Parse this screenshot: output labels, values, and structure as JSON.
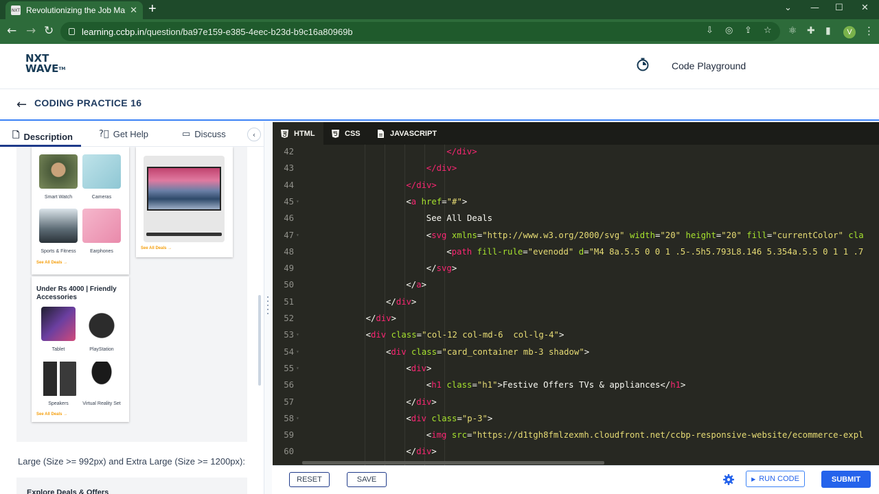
{
  "browser": {
    "tab_title": "Revolutionizing the Job Market |",
    "tab_favicon_text": "NXT",
    "new_tab": "+",
    "url_host": "learning.ccbp.in",
    "url_path": "/question/ba97e159-e385-4eec-b23d-b9c16a80969b",
    "profile_initial": "V"
  },
  "header": {
    "logo_line1": "NXT",
    "logo_line2": "WAVE",
    "logo_tm": "TM",
    "code_playground": "Code Playground",
    "page_title": "CODING PRACTICE 16"
  },
  "left_tabs": {
    "description": "Description",
    "get_help": "Get Help",
    "discuss": "Discuss"
  },
  "preview": {
    "cards": [
      {
        "title": "",
        "items": [
          "Smart Watch",
          "Cameras",
          "Sports & Fitness",
          "Earphones"
        ],
        "see_all": "See All Deals →"
      },
      {
        "title": "",
        "see_all": "See All Deals →"
      },
      {
        "title": "Under Rs 4000 | Friendly Accessories",
        "items": [
          "Tablet",
          "PlayStation",
          "Speakers",
          "Virtual Reality Set"
        ],
        "see_all": "See All Deals →"
      }
    ],
    "description_text": "Large (Size >= 992px) and Extra Large (Size >= 1200px):",
    "explore_title": "Explore Deals & Offers"
  },
  "editor": {
    "tabs": [
      "HTML",
      "CSS",
      "JAVASCRIPT"
    ],
    "active_tab": "HTML",
    "lines": [
      {
        "n": "42",
        "fold": "",
        "indent": 8,
        "html": "<span class='tg'>&lt;/div&gt;</span>"
      },
      {
        "n": "43",
        "fold": "",
        "indent": 7,
        "html": "<span class='tg'>&lt;/div&gt;</span>"
      },
      {
        "n": "44",
        "fold": "",
        "indent": 6,
        "html": "<span class='tg'>&lt;/div&gt;</span>"
      },
      {
        "n": "45",
        "fold": "▾",
        "indent": 6,
        "html": "&lt;<span class='tg'>a</span> <span class='at'>href</span>=<span class='st'>\"#\"</span>&gt;"
      },
      {
        "n": "46",
        "fold": "",
        "indent": 7,
        "html": "See All Deals"
      },
      {
        "n": "47",
        "fold": "▾",
        "indent": 7,
        "html": "&lt;<span class='tg'>svg</span> <span class='at'>xmlns</span>=<span class='st'>\"http://www.w3.org/2000/svg\"</span> <span class='at'>width</span>=<span class='st'>\"20\"</span> <span class='at'>height</span>=<span class='st'>\"20\"</span> <span class='at'>fill</span>=<span class='st'>\"currentColor\"</span> <span class='at'>cla</span>"
      },
      {
        "n": "48",
        "fold": "",
        "indent": 8,
        "html": "&lt;<span class='tg'>path</span> <span class='at'>fill-rule</span>=<span class='st'>\"evenodd\"</span> <span class='at'>d</span>=<span class='st'>\"M4 8a.5.5 0 0 1 .5-.5h5.793L8.146 5.354a.5.5 0 1 1 .7</span>"
      },
      {
        "n": "49",
        "fold": "",
        "indent": 7,
        "html": "&lt;/<span class='tg'>svg</span>&gt;"
      },
      {
        "n": "50",
        "fold": "",
        "indent": 6,
        "html": "&lt;/<span class='tg'>a</span>&gt;"
      },
      {
        "n": "51",
        "fold": "",
        "indent": 5,
        "html": "&lt;/<span class='tg'>div</span>&gt;"
      },
      {
        "n": "52",
        "fold": "",
        "indent": 4,
        "html": "&lt;/<span class='tg'>div</span>&gt;"
      },
      {
        "n": "53",
        "fold": "▾",
        "indent": 4,
        "html": "&lt;<span class='tg'>div</span> <span class='at'>class</span>=<span class='st'>\"col-12 col-md-6  col-lg-4\"</span>&gt;"
      },
      {
        "n": "54",
        "fold": "▾",
        "indent": 5,
        "html": "&lt;<span class='tg'>div</span> <span class='at'>class</span>=<span class='st'>\"card_container mb-3 shadow\"</span>&gt;"
      },
      {
        "n": "55",
        "fold": "▾",
        "indent": 6,
        "html": "&lt;<span class='tg'>div</span>&gt;"
      },
      {
        "n": "56",
        "fold": "",
        "indent": 7,
        "html": "&lt;<span class='tg'>h1</span> <span class='at'>class</span>=<span class='st'>\"h1\"</span>&gt;Festive Offers TVs &amp; appliances&lt;/<span class='tg'>h1</span>&gt;"
      },
      {
        "n": "57",
        "fold": "",
        "indent": 6,
        "html": "&lt;/<span class='tg'>div</span>&gt;"
      },
      {
        "n": "58",
        "fold": "▾",
        "indent": 6,
        "html": "&lt;<span class='tg'>div</span> <span class='at'>class</span>=<span class='st'>\"p-3\"</span>&gt;"
      },
      {
        "n": "59",
        "fold": "",
        "indent": 7,
        "html": "&lt;<span class='tg'>img</span> <span class='at'>src</span>=<span class='st'>\"https://d1tgh8fmlzexmh.cloudfront.net/ccbp-responsive-website/ecommerce-expl</span>"
      },
      {
        "n": "60",
        "fold": "",
        "indent": 6,
        "html": "&lt;/<span class='tg'>div</span>&gt;"
      }
    ]
  },
  "footer": {
    "reset": "RESET",
    "save": "SAVE",
    "run_code": "RUN CODE",
    "submit": "SUBMIT"
  },
  "colors": {
    "browser_green": "#2d6b3a",
    "editor_bg": "#272822",
    "accent_blue": "#2563eb",
    "tag": "#f92672",
    "attr": "#a6e22e",
    "string": "#e6db74"
  }
}
